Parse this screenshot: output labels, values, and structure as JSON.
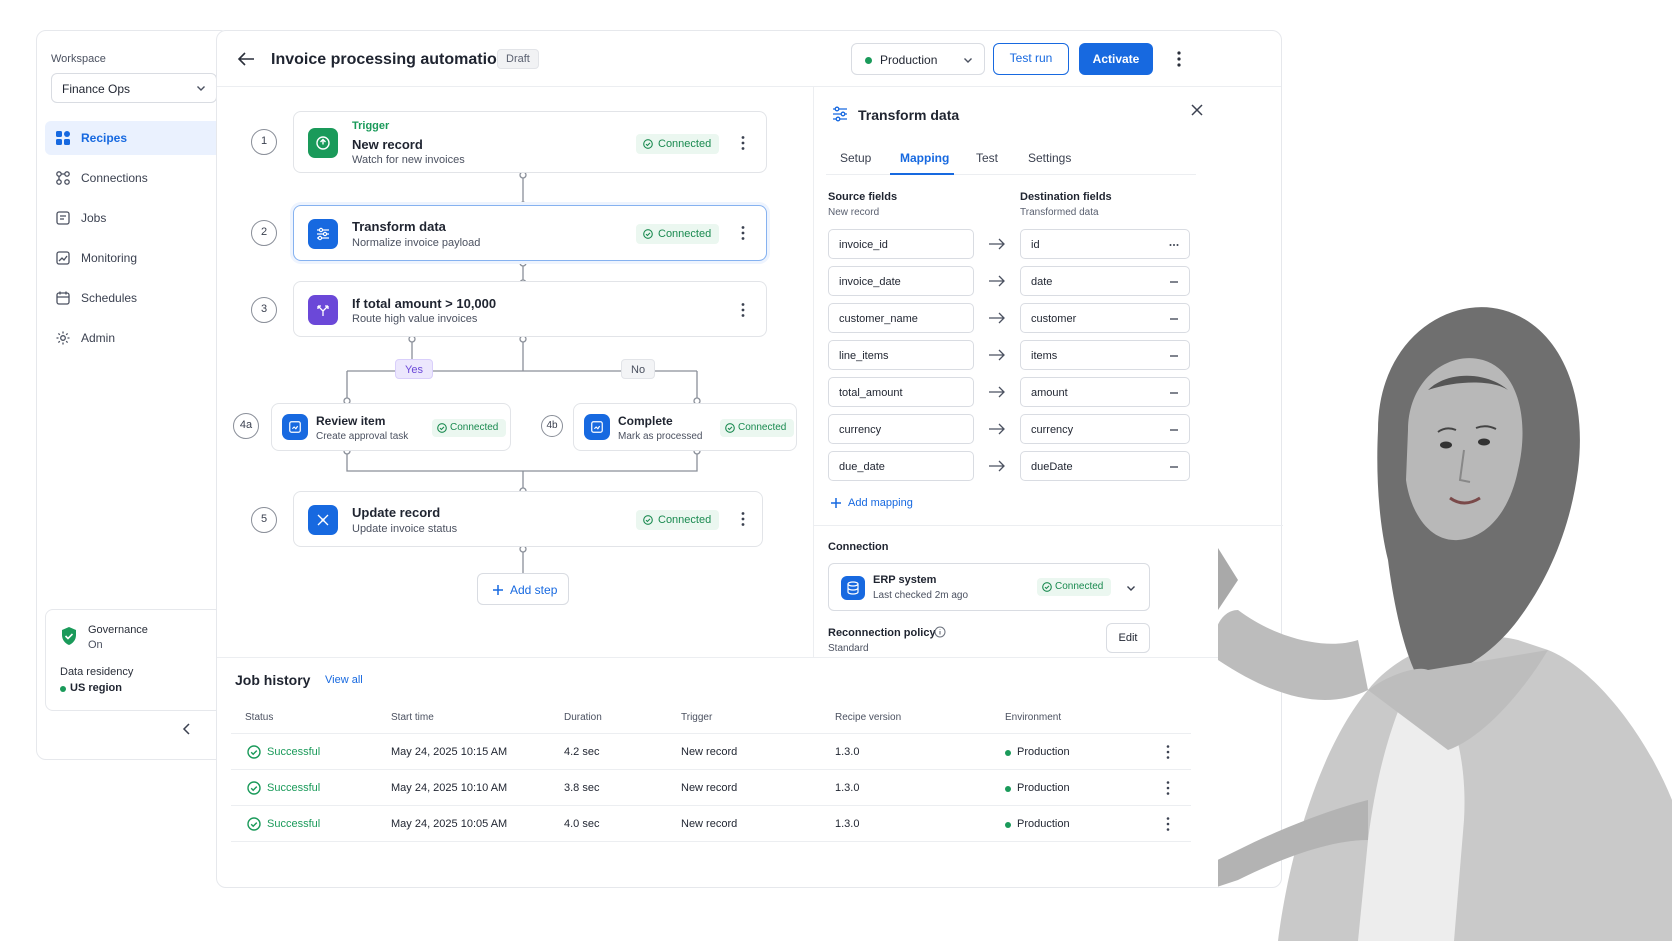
{
  "sidebar": {
    "workspace_label": "Workspace",
    "workspace_value": "Finance Ops",
    "nav": [
      {
        "label": "Recipes",
        "icon": "recipes-icon",
        "active": true
      },
      {
        "label": "Connections",
        "icon": "connections-icon"
      },
      {
        "label": "Jobs",
        "icon": "jobs-icon"
      },
      {
        "label": "Monitoring",
        "icon": "monitoring-icon"
      },
      {
        "label": "Schedules",
        "icon": "schedules-icon"
      },
      {
        "label": "Admin",
        "icon": "gear-icon"
      }
    ],
    "governance": {
      "title": "Governance",
      "status": "On",
      "residency_label": "Data residency",
      "residency_value": "US region"
    }
  },
  "header": {
    "title": "Invoice processing automation",
    "status": "Draft",
    "environment": "Production",
    "test_label": "Test run",
    "activate_label": "Activate"
  },
  "flow": {
    "steps": [
      {
        "num": "1",
        "kind": "Trigger",
        "name": "New record",
        "desc": "Watch for new invoices",
        "status": "Connected"
      },
      {
        "num": "2",
        "name": "Transform data",
        "desc": "Normalize invoice payload",
        "status": "Connected"
      },
      {
        "num": "3",
        "name": "If total amount > 10,000",
        "desc": "Route high value invoices"
      },
      {
        "num": "4a",
        "name": "Review item",
        "desc": "Create approval task",
        "status": "Connected"
      },
      {
        "num": "4b",
        "name": "Complete",
        "desc": "Mark as processed",
        "status": "Connected"
      },
      {
        "num": "5",
        "name": "Update record",
        "desc": "Update invoice status",
        "status": "Connected"
      }
    ],
    "branch_yes": "Yes",
    "branch_no": "No",
    "add_step": "Add step"
  },
  "panel": {
    "title": "Transform data",
    "tabs": [
      "Setup",
      "Mapping",
      "Test",
      "Settings"
    ],
    "active_tab": "Mapping",
    "source_header": "Source fields",
    "source_sub": "New record",
    "dest_header": "Destination fields",
    "dest_sub": "Transformed data",
    "mappings": [
      {
        "source": "invoice_id",
        "dest": "id"
      },
      {
        "source": "invoice_date",
        "dest": "date"
      },
      {
        "source": "customer_name",
        "dest": "customer"
      },
      {
        "source": "line_items",
        "dest": "items"
      },
      {
        "source": "total_amount",
        "dest": "amount"
      },
      {
        "source": "currency",
        "dest": "currency"
      },
      {
        "source": "due_date",
        "dest": "dueDate"
      }
    ],
    "add_mapping": "Add mapping",
    "connection_label": "Connection",
    "connection": {
      "name": "ERP system",
      "checked": "Last checked 2m ago",
      "status": "Connected"
    },
    "policy_label": "Reconnection policy",
    "policy_value": "Standard",
    "edit_label": "Edit"
  },
  "jobs": {
    "title": "Job history",
    "view_all": "View all",
    "columns": [
      "Status",
      "Start time",
      "Duration",
      "Trigger",
      "Recipe version",
      "Environment"
    ],
    "rows": [
      {
        "status": "Successful",
        "start": "May 24, 2025 10:15 AM",
        "duration": "4.2 sec",
        "trigger": "New record",
        "version": "1.3.0",
        "env": "Production"
      },
      {
        "status": "Successful",
        "start": "May 24, 2025 10:10 AM",
        "duration": "3.8 sec",
        "trigger": "New record",
        "version": "1.3.0",
        "env": "Production"
      },
      {
        "status": "Successful",
        "start": "May 24, 2025 10:05 AM",
        "duration": "4.0 sec",
        "trigger": "New record",
        "version": "1.3.0",
        "env": "Production"
      }
    ]
  },
  "colors": {
    "accent": "#1769e0",
    "success": "#1a9a5a",
    "branch": "#6b48d8"
  }
}
